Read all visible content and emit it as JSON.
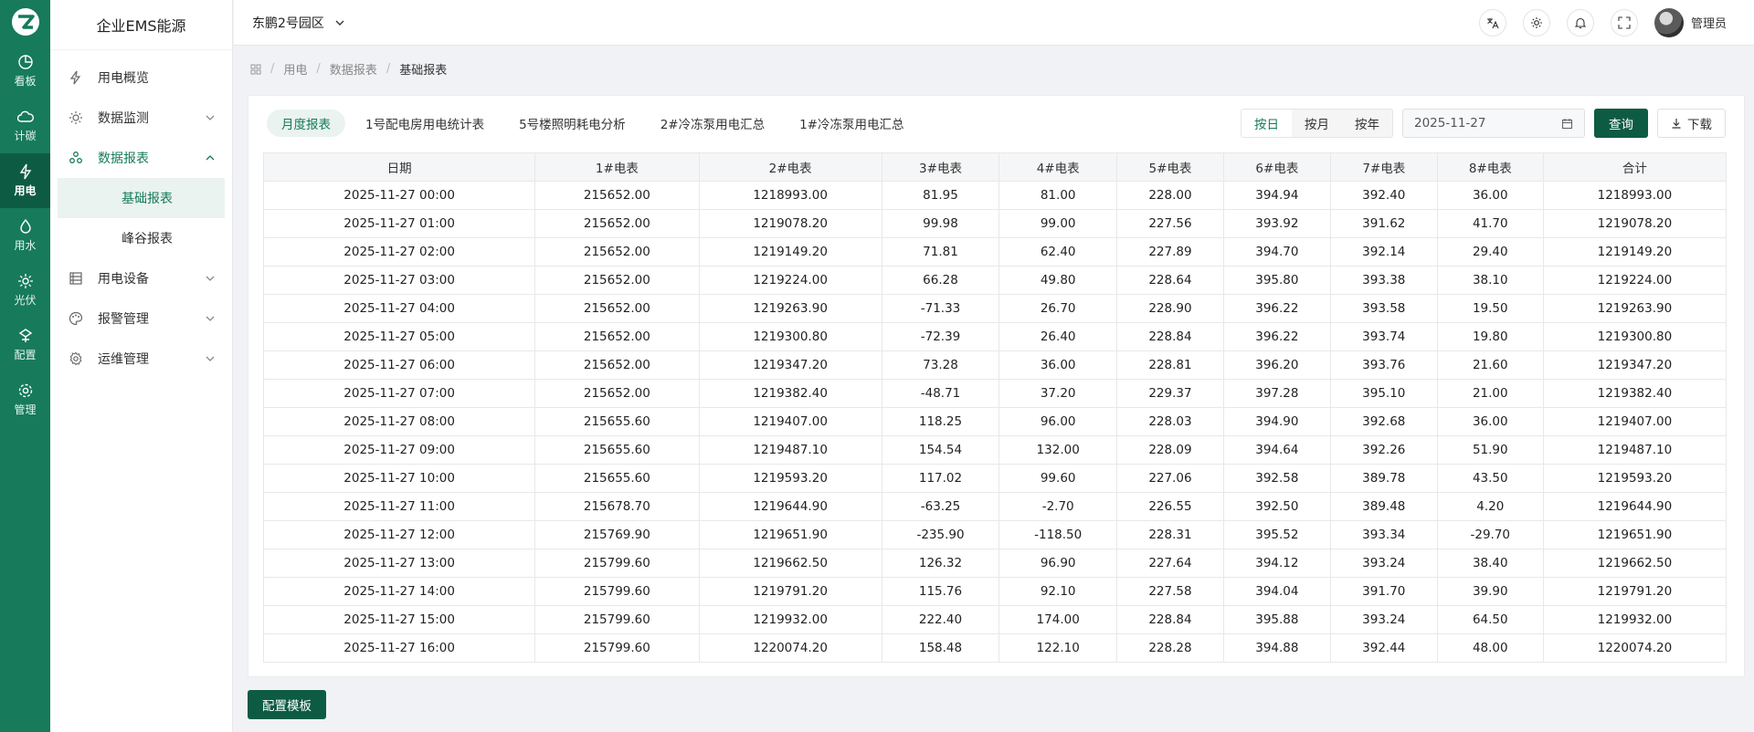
{
  "app": {
    "title": "企业EMS能源",
    "park": "东鹏2号园区",
    "user": "管理员",
    "accent": "#167a5b",
    "accent_dark": "#0e5b43"
  },
  "rail": [
    {
      "label": "看板",
      "icon": "dashboard-icon"
    },
    {
      "label": "计碳",
      "icon": "carbon-cloud-icon"
    },
    {
      "label": "用电",
      "icon": "electricity-icon",
      "active": true
    },
    {
      "label": "用水",
      "icon": "water-drop-icon"
    },
    {
      "label": "光伏",
      "icon": "sun-icon"
    },
    {
      "label": "配置",
      "icon": "config-icon"
    },
    {
      "label": "管理",
      "icon": "gear-icon"
    }
  ],
  "menu": {
    "overview": "用电概览",
    "monitor": "数据监测",
    "report": "数据报表",
    "report_basic": "基础报表",
    "report_peak": "峰谷报表",
    "device": "用电设备",
    "alarm": "报警管理",
    "ops": "运维管理"
  },
  "breadcrumb": {
    "item1": "用电",
    "item2": "数据报表",
    "current": "基础报表"
  },
  "tabs": [
    "月度报表",
    "1号配电房用电统计表",
    "5号楼照明耗电分析",
    "2#冷冻泵用电汇总",
    "1#冷冻泵用电汇总"
  ],
  "period": {
    "day": "按日",
    "month": "按月",
    "year": "按年"
  },
  "date_value": "2025-11-27",
  "buttons": {
    "query": "查询",
    "download": "下载",
    "config_template": "配置模板"
  },
  "table": {
    "headers": [
      "日期",
      "1#电表",
      "2#电表",
      "3#电表",
      "4#电表",
      "5#电表",
      "6#电表",
      "7#电表",
      "8#电表",
      "合计"
    ],
    "rows": [
      [
        "2025-11-27 00:00",
        "215652.00",
        "1218993.00",
        "81.95",
        "81.00",
        "228.00",
        "394.94",
        "392.40",
        "36.00",
        "1218993.00"
      ],
      [
        "2025-11-27 01:00",
        "215652.00",
        "1219078.20",
        "99.98",
        "99.00",
        "227.56",
        "393.92",
        "391.62",
        "41.70",
        "1219078.20"
      ],
      [
        "2025-11-27 02:00",
        "215652.00",
        "1219149.20",
        "71.81",
        "62.40",
        "227.89",
        "394.70",
        "392.14",
        "29.40",
        "1219149.20"
      ],
      [
        "2025-11-27 03:00",
        "215652.00",
        "1219224.00",
        "66.28",
        "49.80",
        "228.64",
        "395.80",
        "393.38",
        "38.10",
        "1219224.00"
      ],
      [
        "2025-11-27 04:00",
        "215652.00",
        "1219263.90",
        "-71.33",
        "26.70",
        "228.90",
        "396.22",
        "393.58",
        "19.50",
        "1219263.90"
      ],
      [
        "2025-11-27 05:00",
        "215652.00",
        "1219300.80",
        "-72.39",
        "26.40",
        "228.84",
        "396.22",
        "393.74",
        "19.80",
        "1219300.80"
      ],
      [
        "2025-11-27 06:00",
        "215652.00",
        "1219347.20",
        "73.28",
        "36.00",
        "228.81",
        "396.20",
        "393.76",
        "21.60",
        "1219347.20"
      ],
      [
        "2025-11-27 07:00",
        "215652.00",
        "1219382.40",
        "-48.71",
        "37.20",
        "229.37",
        "397.28",
        "395.10",
        "21.00",
        "1219382.40"
      ],
      [
        "2025-11-27 08:00",
        "215655.60",
        "1219407.00",
        "118.25",
        "96.00",
        "228.03",
        "394.90",
        "392.68",
        "36.00",
        "1219407.00"
      ],
      [
        "2025-11-27 09:00",
        "215655.60",
        "1219487.10",
        "154.54",
        "132.00",
        "228.09",
        "394.64",
        "392.26",
        "51.90",
        "1219487.10"
      ],
      [
        "2025-11-27 10:00",
        "215655.60",
        "1219593.20",
        "117.02",
        "99.60",
        "227.06",
        "392.58",
        "389.78",
        "43.50",
        "1219593.20"
      ],
      [
        "2025-11-27 11:00",
        "215678.70",
        "1219644.90",
        "-63.25",
        "-2.70",
        "226.55",
        "392.50",
        "389.48",
        "4.20",
        "1219644.90"
      ],
      [
        "2025-11-27 12:00",
        "215769.90",
        "1219651.90",
        "-235.90",
        "-118.50",
        "228.31",
        "395.52",
        "393.34",
        "-29.70",
        "1219651.90"
      ],
      [
        "2025-11-27 13:00",
        "215799.60",
        "1219662.50",
        "126.32",
        "96.90",
        "227.64",
        "394.12",
        "393.24",
        "38.40",
        "1219662.50"
      ],
      [
        "2025-11-27 14:00",
        "215799.60",
        "1219791.20",
        "115.76",
        "92.10",
        "227.58",
        "394.04",
        "391.70",
        "39.90",
        "1219791.20"
      ],
      [
        "2025-11-27 15:00",
        "215799.60",
        "1219932.00",
        "222.40",
        "174.00",
        "228.84",
        "395.88",
        "393.24",
        "64.50",
        "1219932.00"
      ],
      [
        "2025-11-27 16:00",
        "215799.60",
        "1220074.20",
        "158.48",
        "122.10",
        "228.28",
        "394.88",
        "392.44",
        "48.00",
        "1220074.20"
      ]
    ]
  }
}
